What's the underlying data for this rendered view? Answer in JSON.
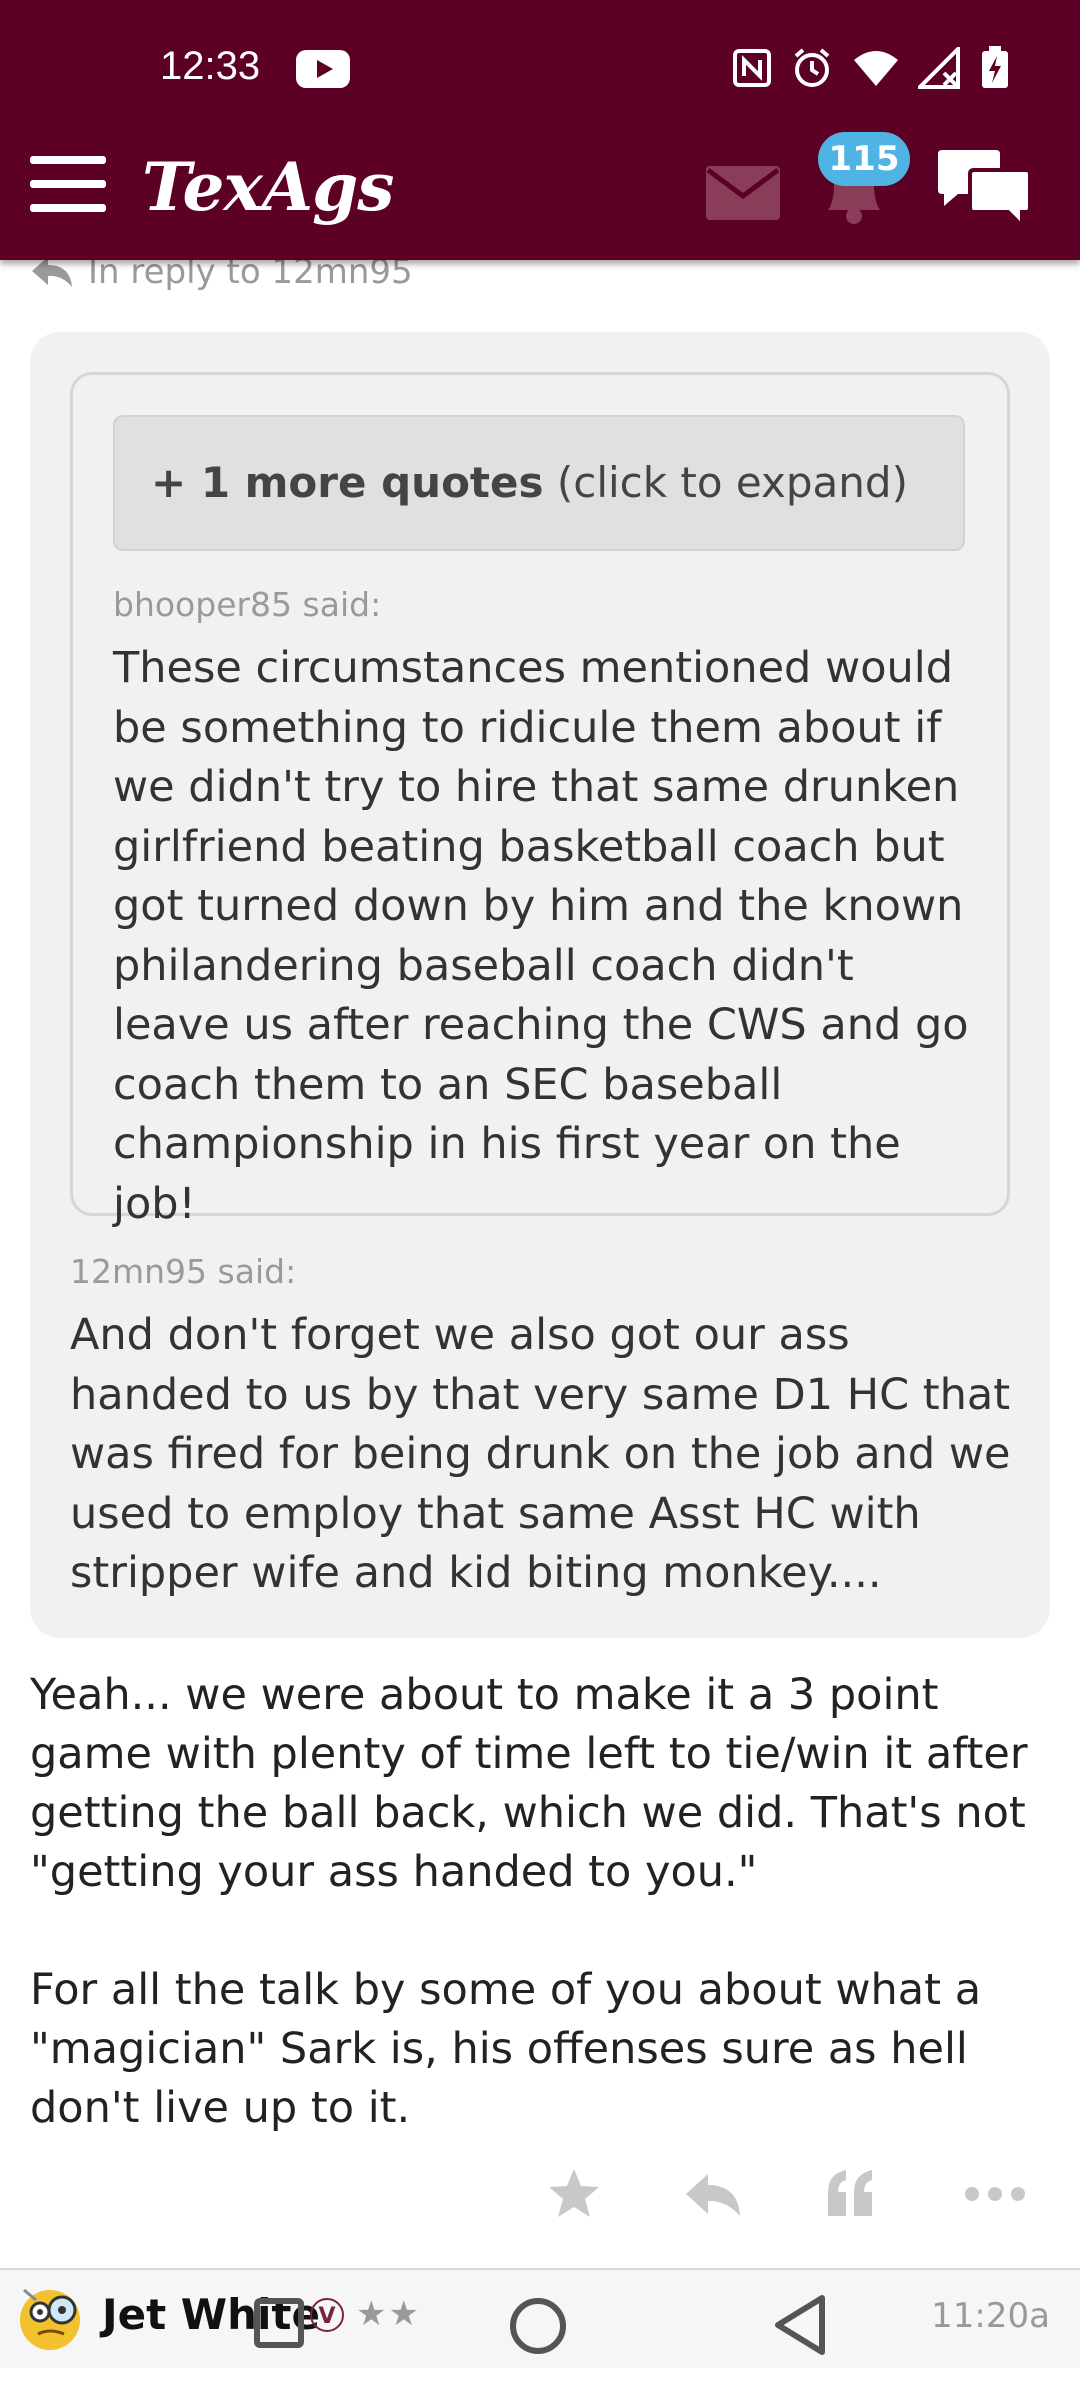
{
  "status_bar": {
    "time": "12:33"
  },
  "header": {
    "logo": "TexAgs",
    "notification_count": "115"
  },
  "reply": {
    "text": "In reply to 12mn95"
  },
  "quotes": {
    "expand_bold": "+ 1 more quotes",
    "expand_rest": " (click to expand)",
    "inner_author": "bhooper85 said:",
    "inner_text": "These circumstances mentioned would be something to ridicule them about if we didn't try to hire that same drunken girlfriend beating basketball coach but got turned down by him and the known philandering baseball coach didn't leave us after reaching the CWS and go coach them to an SEC baseball championship in his first year on the job!",
    "outer_author": "12mn95 said:",
    "outer_text": "And don't forget we also got our ass handed to us by that very same D1 HC that was fired for being drunk on the job and we used to employ that same Asst HC with stripper wife and kid biting monkey...."
  },
  "post": {
    "paragraph1": "Yeah... we were about to make it a 3 point game with plenty of time left to tie/win it after getting the ball back, which we did. That's not \"getting your ass handed to you.\"",
    "paragraph2": "For all the talk by some of you about what a \"magician\" Sark is, his offenses sure as hell don't live up to it."
  },
  "next_post": {
    "username": "Jet White",
    "verified_badge": "V",
    "stars": "★★",
    "time": "11:20a"
  },
  "icons": {
    "menu": "menu-icon",
    "mail": "mail-icon",
    "bell": "bell-icon",
    "chat": "chat-icon",
    "reply": "reply-arrow-icon",
    "star": "star-icon",
    "quote": "quote-icon",
    "more": "more-dots-icon"
  },
  "colors": {
    "header_bg": "#5c0025",
    "badge_bg": "#4fb3e3",
    "quote_bg": "#f1f1f1"
  }
}
